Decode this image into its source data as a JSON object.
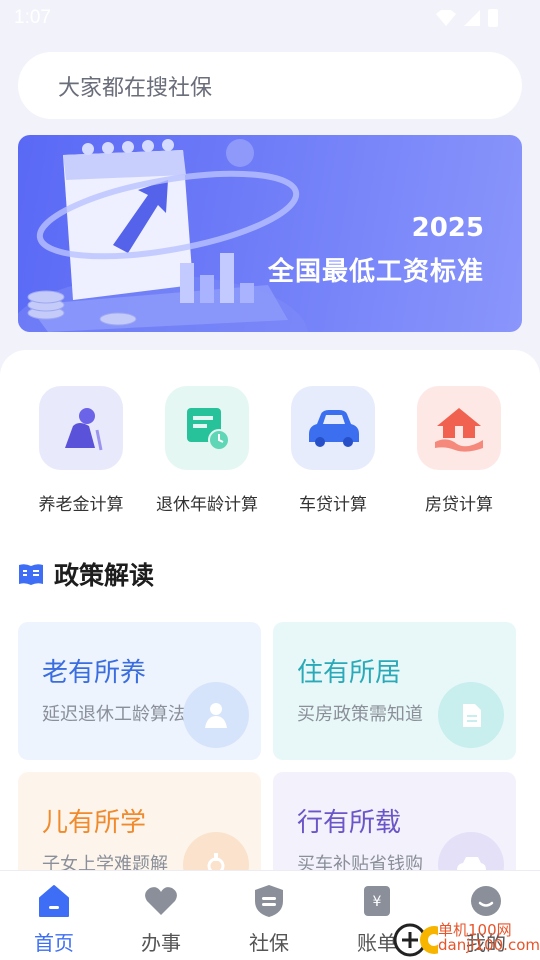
{
  "status_bar": {
    "time": "1:07"
  },
  "search": {
    "placeholder": "大家都在搜社保"
  },
  "banner": {
    "year": "2025",
    "title": "全国最低工资标准"
  },
  "tools": [
    {
      "label": "养老金计算",
      "icon": "elderly-person-icon",
      "bg": "#e8e9fb",
      "color": "#6b63e8"
    },
    {
      "label": "退休年龄计算",
      "icon": "retirement-calendar-icon",
      "bg": "#e4f7f2",
      "color": "#27c29a"
    },
    {
      "label": "车贷计算",
      "icon": "car-icon",
      "bg": "#e6ecfc",
      "color": "#3b6ff0"
    },
    {
      "label": "房贷计算",
      "icon": "house-hand-icon",
      "bg": "#fde8e6",
      "color": "#f06150"
    }
  ],
  "policy": {
    "title": "政策解读",
    "cards": [
      {
        "title": "老有所养",
        "subtitle": "延迟退休工龄算法",
        "title_color": "#3a6ee0",
        "bg": "#eef4fd"
      },
      {
        "title": "住有所居",
        "subtitle": "买房政策需知道",
        "title_color": "#2aaab8",
        "bg": "#e8f8f8"
      },
      {
        "title": "儿有所学",
        "subtitle": "子女上学难题解",
        "title_color": "#f08a2c",
        "bg": "#fdf5ec"
      },
      {
        "title": "行有所载",
        "subtitle": "买车补贴省钱购",
        "title_color": "#6b55c8",
        "bg": "#f3f1fb"
      }
    ]
  },
  "tabbar": {
    "items": [
      {
        "label": "首页",
        "active": true
      },
      {
        "label": "办事",
        "active": false
      },
      {
        "label": "社保",
        "active": false
      },
      {
        "label": "账单",
        "active": false
      },
      {
        "label": "我的",
        "active": false
      }
    ]
  },
  "watermark": {
    "line1": "单机100网",
    "line2": "danji100.com"
  },
  "colors": {
    "accent": "#3d6ef5",
    "banner": "#6473f6",
    "background": "#f2f2fb"
  }
}
